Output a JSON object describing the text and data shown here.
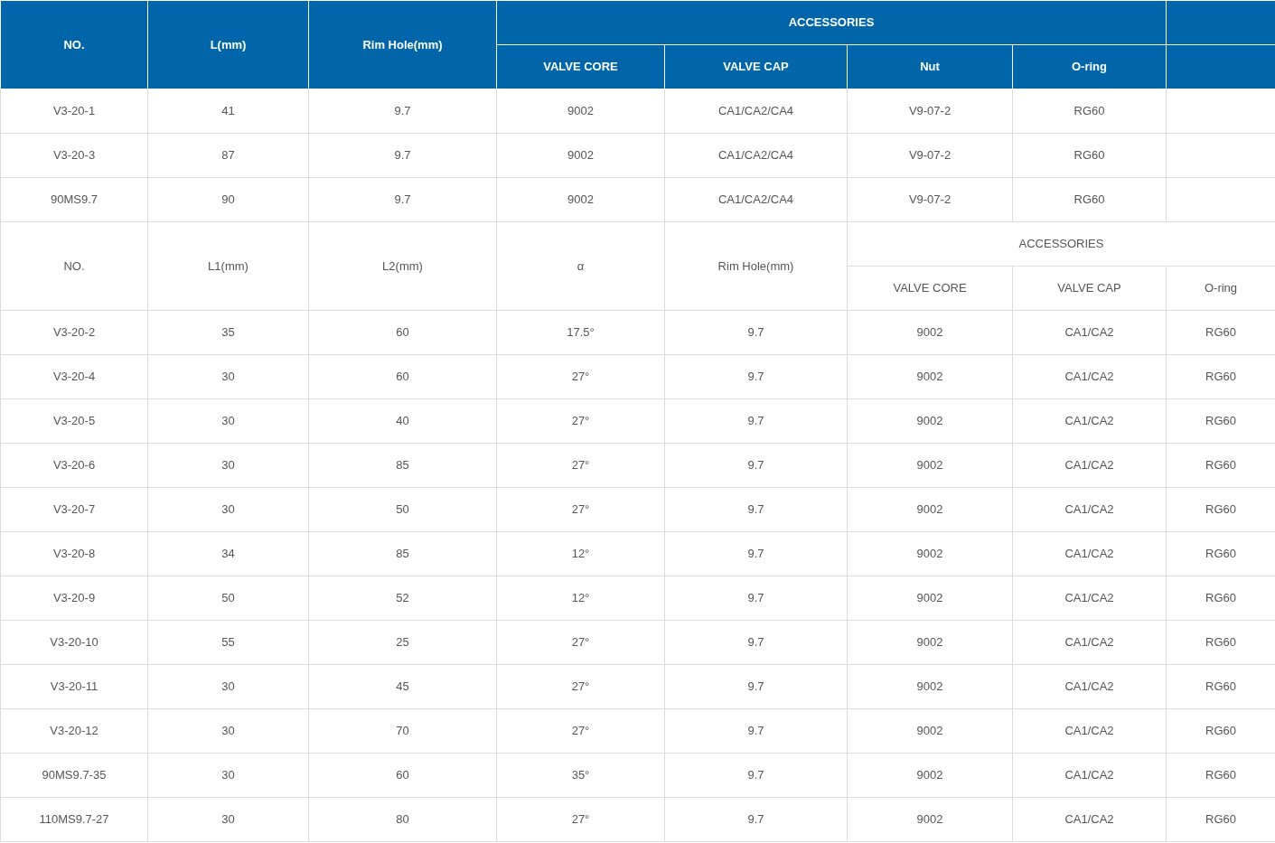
{
  "sections": [
    {
      "header": {
        "columns": [
          "NO.",
          "L(mm)",
          "Rim Hole(mm)"
        ],
        "group_label": "ACCESSORIES",
        "group_columns": [
          "VALVE CORE",
          "VALVE CAP",
          "Nut",
          "O-ring"
        ],
        "kind": "main"
      },
      "rows": [
        [
          "V3-20-1",
          "41",
          "9.7",
          "9002",
          "CA1/CA2/CA4",
          "V9-07-2",
          "RG60"
        ],
        [
          "V3-20-3",
          "87",
          "9.7",
          "9002",
          "CA1/CA2/CA4",
          "V9-07-2",
          "RG60"
        ],
        [
          "90MS9.7",
          "90",
          "9.7",
          "9002",
          "CA1/CA2/CA4",
          "V9-07-2",
          "RG60"
        ]
      ]
    },
    {
      "header": {
        "columns": [
          "NO.",
          "L1(mm)",
          "L2(mm)",
          "α",
          "Rim Hole(mm)"
        ],
        "group_label": "ACCESSORIES",
        "group_columns": [
          "VALVE CORE",
          "VALVE CAP",
          "O-ring"
        ],
        "kind": "sub"
      },
      "rows": [
        [
          "V3-20-2",
          "35",
          "60",
          "17.5°",
          "9.7",
          "9002",
          "CA1/CA2",
          "RG60"
        ],
        [
          "V3-20-4",
          "30",
          "60",
          "27°",
          "9.7",
          "9002",
          "CA1/CA2",
          "RG60"
        ],
        [
          "V3-20-5",
          "30",
          "40",
          "27°",
          "9.7",
          "9002",
          "CA1/CA2",
          "RG60"
        ],
        [
          "V3-20-6",
          "30",
          "85",
          "27°",
          "9.7",
          "9002",
          "CA1/CA2",
          "RG60"
        ],
        [
          "V3-20-7",
          "30",
          "50",
          "27°",
          "9.7",
          "9002",
          "CA1/CA2",
          "RG60"
        ],
        [
          "V3-20-8",
          "34",
          "85",
          "12°",
          "9.7",
          "9002",
          "CA1/CA2",
          "RG60"
        ],
        [
          "V3-20-9",
          "50",
          "52",
          "12°",
          "9.7",
          "9002",
          "CA1/CA2",
          "RG60"
        ],
        [
          "V3-20-10",
          "55",
          "25",
          "27°",
          "9.7",
          "9002",
          "CA1/CA2",
          "RG60"
        ],
        [
          "V3-20-11",
          "30",
          "45",
          "27°",
          "9.7",
          "9002",
          "CA1/CA2",
          "RG60"
        ],
        [
          "V3-20-12",
          "30",
          "70",
          "27°",
          "9.7",
          "9002",
          "CA1/CA2",
          "RG60"
        ],
        [
          "90MS9.7-35",
          "30",
          "60",
          "35°",
          "9.7",
          "9002",
          "CA1/CA2",
          "RG60"
        ],
        [
          "110MS9.7-27",
          "30",
          "80",
          "27°",
          "9.7",
          "9002",
          "CA1/CA2",
          "RG60"
        ]
      ]
    }
  ]
}
